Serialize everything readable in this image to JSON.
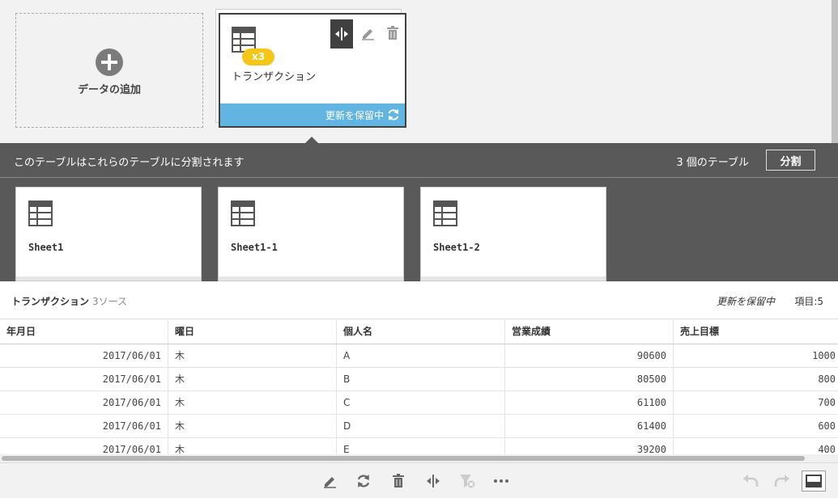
{
  "add_data": {
    "label": "データの追加"
  },
  "table_card": {
    "badge": "x3",
    "name": "トランザクション",
    "status": "更新を保留中"
  },
  "split_panel": {
    "message": "このテーブルはこれらのテーブルに分割されます",
    "count": "3 個のテーブル",
    "split_button": "分割",
    "tables": [
      {
        "name": "Sheet1"
      },
      {
        "name": "Sheet1-1"
      },
      {
        "name": "Sheet1-2"
      }
    ]
  },
  "preview": {
    "title": "トランザクション",
    "sources": "3ソース",
    "pending": "更新を保留中",
    "fields": "項目:5",
    "columns": [
      "年月日",
      "曜日",
      "個人名",
      "営業成績",
      "売上目標"
    ],
    "rows": [
      [
        "2017/06/01",
        "木",
        "A",
        "90600",
        "1000"
      ],
      [
        "2017/06/01",
        "木",
        "B",
        "80500",
        "800"
      ],
      [
        "2017/06/01",
        "木",
        "C",
        "61100",
        "700"
      ],
      [
        "2017/06/01",
        "木",
        "D",
        "61400",
        "600"
      ],
      [
        "2017/06/01",
        "木",
        "E",
        "39200",
        "400"
      ]
    ]
  },
  "toolbar": {
    "icons": [
      "pencil-icon",
      "refresh-icon",
      "trash-icon",
      "split-icon",
      "filter-clear-icon",
      "more-icon",
      "undo-icon",
      "redo-icon",
      "panel-toggle-icon"
    ]
  },
  "colors": {
    "accent_blue": "#62b5e0",
    "badge_yellow": "#f5c518",
    "panel_dark": "#595959"
  }
}
